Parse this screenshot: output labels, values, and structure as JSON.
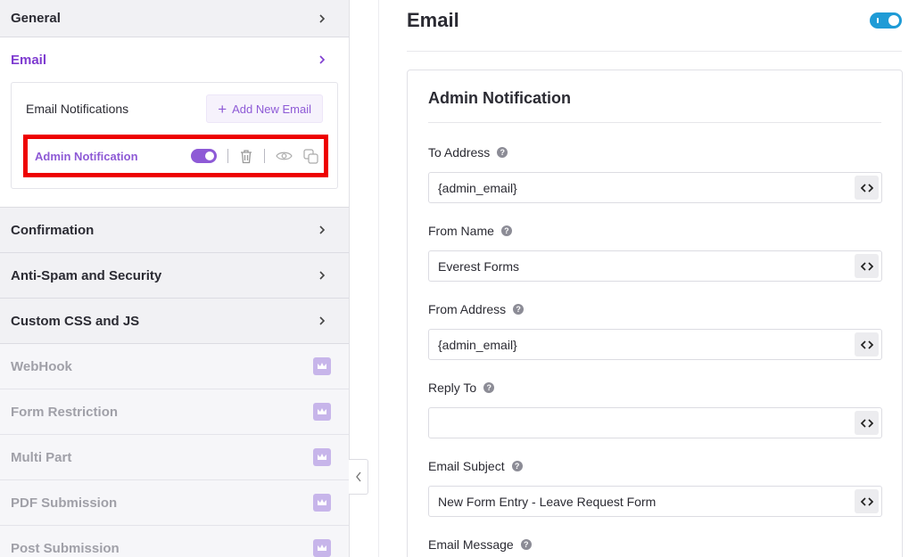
{
  "sidebar": {
    "general": {
      "label": "General"
    },
    "email": {
      "label": "Email",
      "notifications_title": "Email Notifications",
      "add_button": "Add New Email",
      "items": [
        {
          "name": "Admin Notification",
          "enabled": true
        }
      ]
    },
    "sections": [
      {
        "label": "Confirmation"
      },
      {
        "label": "Anti-Spam and Security"
      },
      {
        "label": "Custom CSS and JS"
      }
    ],
    "pro_sections": [
      {
        "label": "WebHook",
        "icon": "crown-icon"
      },
      {
        "label": "Form Restriction",
        "icon": "crown-icon"
      },
      {
        "label": "Multi Part",
        "icon": "crown-icon"
      },
      {
        "label": "PDF Submission",
        "icon": "crown-icon"
      },
      {
        "label": "Post Submission",
        "icon": "crown-icon"
      }
    ]
  },
  "main": {
    "title": "Email",
    "enabled": true,
    "card_title": "Admin Notification",
    "fields": [
      {
        "label": "To Address",
        "value": "{admin_email}"
      },
      {
        "label": "From Name",
        "value": "Everest Forms"
      },
      {
        "label": "From Address",
        "value": "{admin_email}"
      },
      {
        "label": "Reply To",
        "value": ""
      },
      {
        "label": "Email Subject",
        "value": "New Form Entry - Leave Request Form"
      },
      {
        "label": "Email Message"
      }
    ]
  },
  "colors": {
    "accent_purple": "#8e5ad6",
    "toggle_blue": "#1f9bd6",
    "highlight_red": "#ee0000"
  }
}
